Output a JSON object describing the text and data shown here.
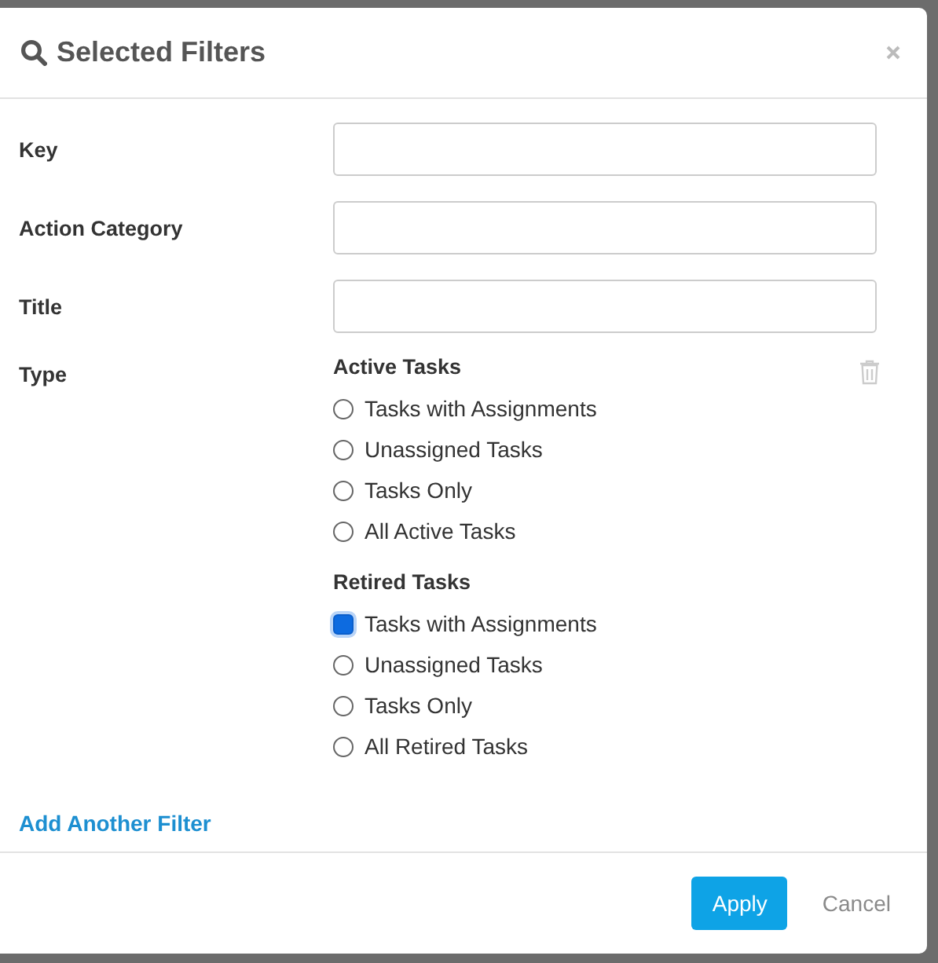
{
  "dialog": {
    "title": "Selected Filters",
    "fields": [
      {
        "label": "Key"
      },
      {
        "label": "Action Category"
      },
      {
        "label": "Title"
      }
    ],
    "type": {
      "label": "Type",
      "groups": [
        {
          "heading": "Active Tasks",
          "options": [
            {
              "label": "Tasks with Assignments",
              "selected": false
            },
            {
              "label": "Unassigned Tasks",
              "selected": false
            },
            {
              "label": "Tasks Only",
              "selected": false
            },
            {
              "label": "All Active Tasks",
              "selected": false
            }
          ]
        },
        {
          "heading": "Retired Tasks",
          "options": [
            {
              "label": "Tasks with Assignments",
              "selected": true
            },
            {
              "label": "Unassigned Tasks",
              "selected": false
            },
            {
              "label": "Tasks Only",
              "selected": false
            },
            {
              "label": "All Retired Tasks",
              "selected": false
            }
          ]
        }
      ]
    },
    "add_link": "Add Another Filter",
    "buttons": [
      {
        "label": "Apply",
        "kind": "primary"
      },
      {
        "label": "Cancel",
        "kind": "secondary"
      }
    ]
  }
}
